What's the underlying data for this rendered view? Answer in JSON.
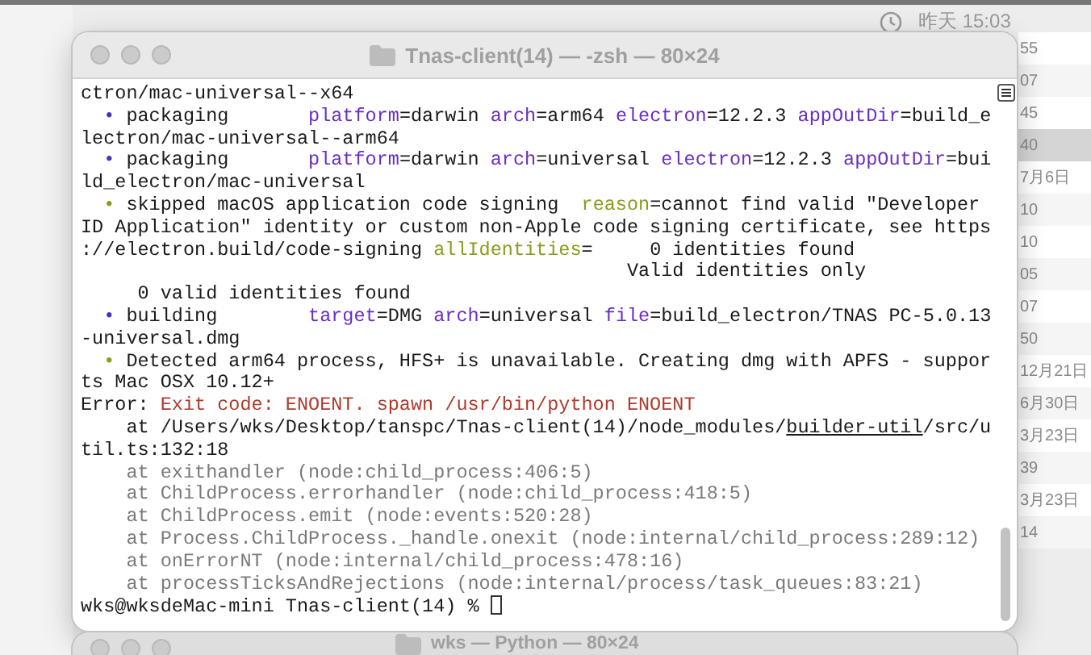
{
  "menu_bar": {
    "time": "昨天 15:03"
  },
  "background_list": {
    "rows": [
      {
        "text": "55",
        "selected": false
      },
      {
        "text": "07",
        "selected": false
      },
      {
        "text": "45",
        "selected": false
      },
      {
        "text": "40",
        "selected": true
      },
      {
        "text": "7月6日",
        "selected": false
      },
      {
        "text": "10",
        "selected": false
      },
      {
        "text": "10",
        "selected": false
      },
      {
        "text": "05",
        "selected": false
      },
      {
        "text": "07",
        "selected": false
      },
      {
        "text": "50",
        "selected": false
      },
      {
        "text": "12月21日",
        "selected": false
      },
      {
        "text": "6月30日",
        "selected": false
      },
      {
        "text": "3月23日",
        "selected": false
      },
      {
        "text": "39",
        "selected": false
      },
      {
        "text": "3月23日",
        "selected": false
      },
      {
        "text": "14",
        "selected": false
      }
    ]
  },
  "terminal": {
    "title": "Tnas-client(14) — -zsh — 80×24",
    "lines": [
      [
        {
          "text": "ctron/mac-universal--x64",
          "kind": "plain"
        }
      ],
      [
        {
          "text": "  •",
          "kind": "info_bullet"
        },
        {
          "text": " packaging       ",
          "kind": "plain"
        },
        {
          "text": "platform",
          "kind": "key"
        },
        {
          "text": "=darwin ",
          "kind": "plain"
        },
        {
          "text": "arch",
          "kind": "key"
        },
        {
          "text": "=arm64 ",
          "kind": "plain"
        },
        {
          "text": "electron",
          "kind": "key"
        },
        {
          "text": "=12.2.3 ",
          "kind": "plain"
        },
        {
          "text": "appOutDir",
          "kind": "key"
        },
        {
          "text": "=build_e",
          "kind": "plain"
        }
      ],
      [
        {
          "text": "lectron/mac-universal--arm64",
          "kind": "plain"
        }
      ],
      [
        {
          "text": "  •",
          "kind": "info_bullet"
        },
        {
          "text": " packaging       ",
          "kind": "plain"
        },
        {
          "text": "platform",
          "kind": "key"
        },
        {
          "text": "=darwin ",
          "kind": "plain"
        },
        {
          "text": "arch",
          "kind": "key"
        },
        {
          "text": "=universal ",
          "kind": "plain"
        },
        {
          "text": "electron",
          "kind": "key"
        },
        {
          "text": "=12.2.3 ",
          "kind": "plain"
        },
        {
          "text": "appOutDir",
          "kind": "key"
        },
        {
          "text": "=bui",
          "kind": "plain"
        }
      ],
      [
        {
          "text": "ld_electron/mac-universal",
          "kind": "plain"
        }
      ],
      [
        {
          "text": "  •",
          "kind": "warn_bullet"
        },
        {
          "text": " skipped macOS application code signing  ",
          "kind": "plain"
        },
        {
          "text": "reason",
          "kind": "warn_key"
        },
        {
          "text": "=cannot find valid \"Developer",
          "kind": "plain"
        }
      ],
      [
        {
          "text": "ID Application\" identity or custom non-Apple code signing certificate, see https",
          "kind": "plain"
        }
      ],
      [
        {
          "text": "://electron.build/code-signing ",
          "kind": "plain"
        },
        {
          "text": "allIdentities",
          "kind": "warn_key"
        },
        {
          "text": "=     0 identities found",
          "kind": "plain"
        }
      ],
      [
        {
          "text": "                                                Valid identities only",
          "kind": "plain"
        }
      ],
      [
        {
          "text": "     0 valid identities found",
          "kind": "plain"
        }
      ],
      [
        {
          "text": "  •",
          "kind": "info_bullet"
        },
        {
          "text": " building        ",
          "kind": "plain"
        },
        {
          "text": "target",
          "kind": "key"
        },
        {
          "text": "=DMG ",
          "kind": "plain"
        },
        {
          "text": "arch",
          "kind": "key"
        },
        {
          "text": "=universal ",
          "kind": "plain"
        },
        {
          "text": "file",
          "kind": "key"
        },
        {
          "text": "=build_electron/TNAS PC-5.0.13",
          "kind": "plain"
        }
      ],
      [
        {
          "text": "-universal.dmg",
          "kind": "plain"
        }
      ],
      [
        {
          "text": "  •",
          "kind": "warn_bullet"
        },
        {
          "text": " Detected arm64 process, HFS+ is unavailable. Creating dmg with APFS - suppor",
          "kind": "plain"
        }
      ],
      [
        {
          "text": "ts Mac OSX 10.12+",
          "kind": "plain"
        }
      ],
      [
        {
          "text": "Error: ",
          "kind": "plain"
        },
        {
          "text": "Exit code: ENOENT. spawn /usr/bin/python ENOENT",
          "kind": "error"
        }
      ],
      [
        {
          "text": "    at /Users/wks/Desktop/tanspc/Tnas-client(14)/node_modules/",
          "kind": "plain"
        },
        {
          "text": "builder-util",
          "kind": "link"
        },
        {
          "text": "/src/u",
          "kind": "plain"
        }
      ],
      [
        {
          "text": "til.ts:132:18",
          "kind": "plain"
        }
      ],
      [
        {
          "text": "    at exithandler (node:child_process:406:5)",
          "kind": "dim"
        }
      ],
      [
        {
          "text": "    at ChildProcess.errorhandler (node:child_process:418:5)",
          "kind": "dim"
        }
      ],
      [
        {
          "text": "    at ChildProcess.emit (node:events:520:28)",
          "kind": "dim"
        }
      ],
      [
        {
          "text": "    at Process.ChildProcess._handle.onexit (node:internal/child_process:289:12)",
          "kind": "dim"
        }
      ],
      [
        {
          "text": "    at onErrorNT (node:internal/child_process:478:16)",
          "kind": "dim"
        }
      ],
      [
        {
          "text": "    at processTicksAndRejections (node:internal/process/task_queues:83:21)",
          "kind": "dim"
        }
      ]
    ],
    "prompt": "wks@wksdeMac-mini Tnas-client(14) % "
  },
  "second_window": {
    "title": "wks — Python — 80×24"
  }
}
